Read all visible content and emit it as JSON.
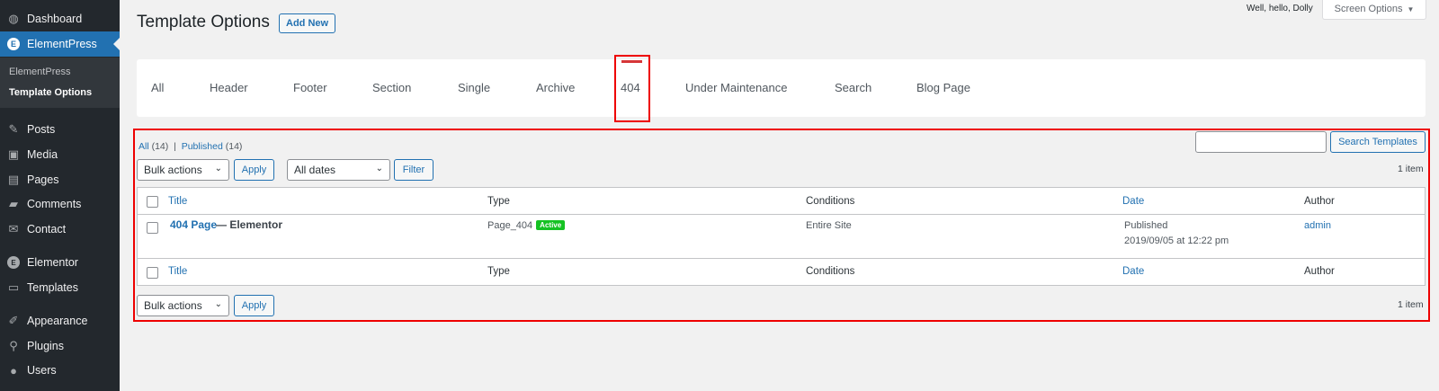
{
  "sidebar": {
    "items": [
      {
        "label": "Dashboard",
        "icon": "dashboard-icon"
      },
      {
        "label": "ElementPress",
        "icon": "elementpress-logo-icon"
      },
      {
        "label": "Posts",
        "icon": "pin-icon"
      },
      {
        "label": "Media",
        "icon": "media-icon"
      },
      {
        "label": "Pages",
        "icon": "pages-icon"
      },
      {
        "label": "Comments",
        "icon": "comment-icon"
      },
      {
        "label": "Contact",
        "icon": "mail-icon"
      },
      {
        "label": "Elementor",
        "icon": "elementor-logo-icon"
      },
      {
        "label": "Templates",
        "icon": "folder-icon"
      },
      {
        "label": "Appearance",
        "icon": "paintbrush-icon"
      },
      {
        "label": "Plugins",
        "icon": "plugin-icon"
      },
      {
        "label": "Users",
        "icon": "user-icon"
      }
    ],
    "submenu": [
      "ElementPress",
      "Template Options"
    ],
    "ep_logo_letter": "E",
    "el_logo_letter": "E"
  },
  "header": {
    "title": "Template Options",
    "add_new": "Add New",
    "howdy": "Well, hello, Dolly",
    "screen_options": "Screen Options"
  },
  "tabs": [
    "All",
    "Header",
    "Footer",
    "Section",
    "Single",
    "Archive",
    "404",
    "Under Maintenance",
    "Search",
    "Blog Page"
  ],
  "filters": {
    "all_label": "All",
    "all_count": "(14)",
    "sep": "|",
    "published_label": "Published",
    "published_count": "(14)",
    "search_button": "Search Templates",
    "bulk_actions": "Bulk actions",
    "apply": "Apply",
    "all_dates": "All dates",
    "filter": "Filter",
    "item_count": "1 item"
  },
  "table": {
    "columns": [
      "Title",
      "Type",
      "Conditions",
      "Date",
      "Author"
    ],
    "row": {
      "title": "404 Page",
      "title_suffix": "— Elementor",
      "type": "Page_404",
      "badge": "Active",
      "conditions": "Entire Site",
      "date_status": "Published",
      "date_value": "2019/09/05 at 12:22 pm",
      "author": "admin"
    }
  },
  "colors": {
    "sidebar": "#23282d",
    "accent": "#2271b1",
    "highlight": "#ee0000",
    "badge": "#15c223"
  }
}
